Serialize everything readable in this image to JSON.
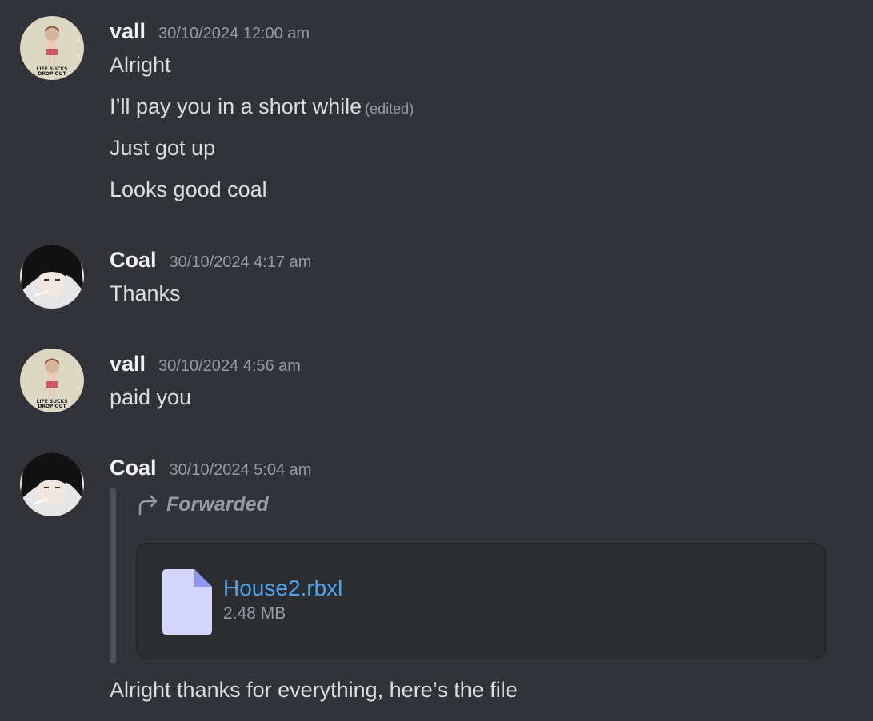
{
  "messages": [
    {
      "author": "vall",
      "timestamp": "30/10/2024 12:00 am",
      "lines": [
        "Alright",
        "I’ll pay you in a short while",
        "Just got up",
        "Looks good coal"
      ],
      "edited_label": "(edited)"
    },
    {
      "author": "Coal",
      "timestamp": "30/10/2024 4:17 am",
      "lines": [
        "Thanks"
      ]
    },
    {
      "author": "vall",
      "timestamp": "30/10/2024 4:56 am",
      "lines": [
        "paid you"
      ]
    },
    {
      "author": "Coal",
      "timestamp": "30/10/2024 5:04 am",
      "forwarded_label": "Forwarded",
      "attachment": {
        "name": "House2.rbxl",
        "size": "2.48 MB"
      },
      "lines": [
        "Alright thanks for everything, here’s the file"
      ]
    }
  ],
  "avatar_texts": {
    "vall": [
      "LIFE SUCKS",
      "DROP OUT"
    ]
  },
  "colors": {
    "background": "#313338",
    "username": "#f2f3f5",
    "timestamp": "#949ba4",
    "link": "#4ea3ea",
    "file_icon": "#d4d6ff"
  }
}
